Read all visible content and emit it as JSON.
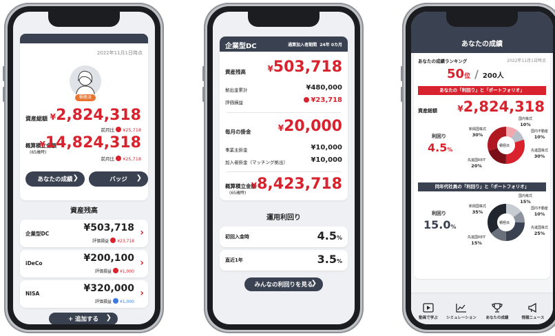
{
  "phone1": {
    "date": "2022年11月1日時点",
    "avatar_badge": "積極派",
    "total_assets_label": "資産総額",
    "total_assets_value": "2,824,318",
    "prev_label": "前月比",
    "total_prev_value": "¥25,718",
    "projected_label": "概算積立金額",
    "projected_sub": "(65歳時)",
    "projected_value": "14,824,318",
    "projected_prev_value": "¥25,718",
    "btn_results": "あなたの成績",
    "btn_badge": "バッジ",
    "section_title": "資産残高",
    "accounts": [
      {
        "name": "企業型DC",
        "amount": "¥503,718",
        "gain_label": "評価損益",
        "gain": "¥23,718",
        "dir": "up"
      },
      {
        "name": "iDeCo",
        "amount": "¥200,100",
        "gain_label": "評価損益",
        "gain": "¥1,000",
        "dir": "up"
      },
      {
        "name": "NISA",
        "amount": "¥320,000",
        "gain_label": "評価損益",
        "gain": "¥1,000",
        "dir": "down"
      }
    ],
    "add_button": "+ 追加する"
  },
  "phone2": {
    "title": "企業型DC",
    "period_label": "通算加入者期間",
    "period_value": "24年 0カ月",
    "balance_label": "資産残高",
    "balance_value": "503,718",
    "contrib_label": "拠出金累計",
    "contrib_value": "¥480,000",
    "eval_label": "評価損益",
    "eval_value": "¥23,718",
    "monthly_label": "毎月の掛金",
    "monthly_value": "20,000",
    "employer_label": "事業主掛金",
    "employer_value": "¥10,000",
    "member_label": "加入者掛金（マッチング拠出）",
    "member_value": "¥10,000",
    "projected_label": "概算積立金額",
    "projected_sub": "(65歳時)",
    "projected_value": "8,423,718",
    "yield_title": "運用利回り",
    "yield_rows": [
      {
        "label": "初回入金時",
        "value": "4.5",
        "unit": "%"
      },
      {
        "label": "直近1年",
        "value": "3.5",
        "unit": "%"
      }
    ],
    "see_all_button": "みんなの利回りを見る"
  },
  "phone3": {
    "title": "あなたの成績",
    "ranking_label": "あなたの成績ランキング",
    "date": "2022年11月1日時点",
    "rank_value": "50",
    "rank_unit": "位",
    "rank_total": "200人",
    "banner1": "あなたの「利回り」と「ポートフォリオ」",
    "total_assets_label": "資産総額",
    "total_assets_value": "2,824,318",
    "yield_label": "利回り",
    "yield_value": "4.5",
    "yield_unit": "%",
    "donut1_center": "積極派",
    "donut1": [
      {
        "name": "国内株式",
        "value": "10%",
        "color": "#f2a7ad"
      },
      {
        "name": "国内不動産",
        "value": "10%",
        "color": "#b9bfc8"
      },
      {
        "name": "先進国株式",
        "value": "30%",
        "color": "#d8222d"
      },
      {
        "name": "先進国REIT",
        "value": "20%",
        "color": "#7a0f18"
      },
      {
        "name": "新興国株式",
        "value": "30%",
        "color": "#b01822"
      }
    ],
    "banner2": "同年代社員の「利回り」と「ポートフォリオ」",
    "peer_yield_label": "利回り",
    "peer_yield_value": "15.0",
    "peer_yield_unit": "%",
    "donut2_center": "積極派",
    "donut2": [
      {
        "name": "国内株式",
        "value": "15%",
        "color": "#c7ccd3"
      },
      {
        "name": "国内不動産",
        "value": "10%",
        "color": "#8d949f"
      },
      {
        "name": "先進国株式",
        "value": "25%",
        "color": "#3a4150"
      },
      {
        "name": "先進国REIT",
        "value": "15%",
        "color": "#6a717c"
      },
      {
        "name": "新興国株式",
        "value": "35%",
        "color": "#20252e"
      }
    ],
    "tabs": [
      "動画で学ぶ",
      "シミュレーション",
      "あなたの成績",
      "情報ニュース"
    ]
  },
  "colors": {
    "accent": "#d8222d",
    "navy": "#3a4150",
    "bg": "#eef0f3"
  }
}
